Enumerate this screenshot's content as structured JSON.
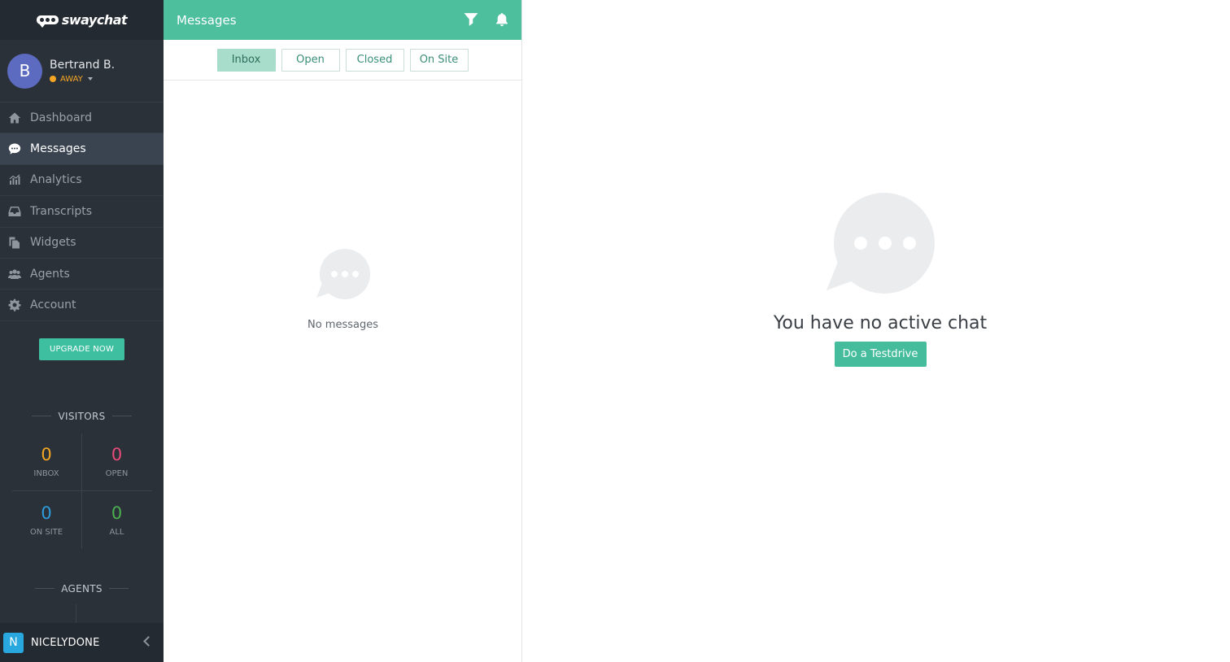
{
  "brand": {
    "name": "swaychat"
  },
  "user": {
    "initial": "B",
    "name": "Bertrand B.",
    "status": "AWAY"
  },
  "nav": [
    {
      "label": "Dashboard",
      "icon": "home-icon"
    },
    {
      "label": "Messages",
      "icon": "chat-icon",
      "active": true
    },
    {
      "label": "Analytics",
      "icon": "bar-chart-icon"
    },
    {
      "label": "Transcripts",
      "icon": "inbox-icon"
    },
    {
      "label": "Widgets",
      "icon": "copy-icon"
    },
    {
      "label": "Agents",
      "icon": "users-icon"
    },
    {
      "label": "Account",
      "icon": "gear-icon"
    }
  ],
  "upgrade": {
    "label": "UPGRADE NOW"
  },
  "visitors": {
    "title": "VISITORS",
    "stats": [
      {
        "value": "0",
        "label": "INBOX",
        "color": "#f5a623"
      },
      {
        "value": "0",
        "label": "OPEN",
        "color": "#e84a7a"
      },
      {
        "value": "0",
        "label": "ON SITE",
        "color": "#2d9cdb"
      },
      {
        "value": "0",
        "label": "ALL",
        "color": "#4caf50"
      }
    ]
  },
  "agents": {
    "title": "AGENTS"
  },
  "workspace": {
    "initial": "N",
    "name": "NICELYDONE"
  },
  "messages_panel": {
    "title": "Messages",
    "tabs": [
      "Inbox",
      "Open",
      "Closed",
      "On Site"
    ],
    "active_tab": "Inbox",
    "empty_text": "No messages"
  },
  "chat": {
    "empty_title": "You have no active chat",
    "cta_label": "Do a Testdrive"
  },
  "colors": {
    "accent": "#4dbf9d",
    "sidebar": "#2b3139",
    "away": "#f5a623"
  }
}
